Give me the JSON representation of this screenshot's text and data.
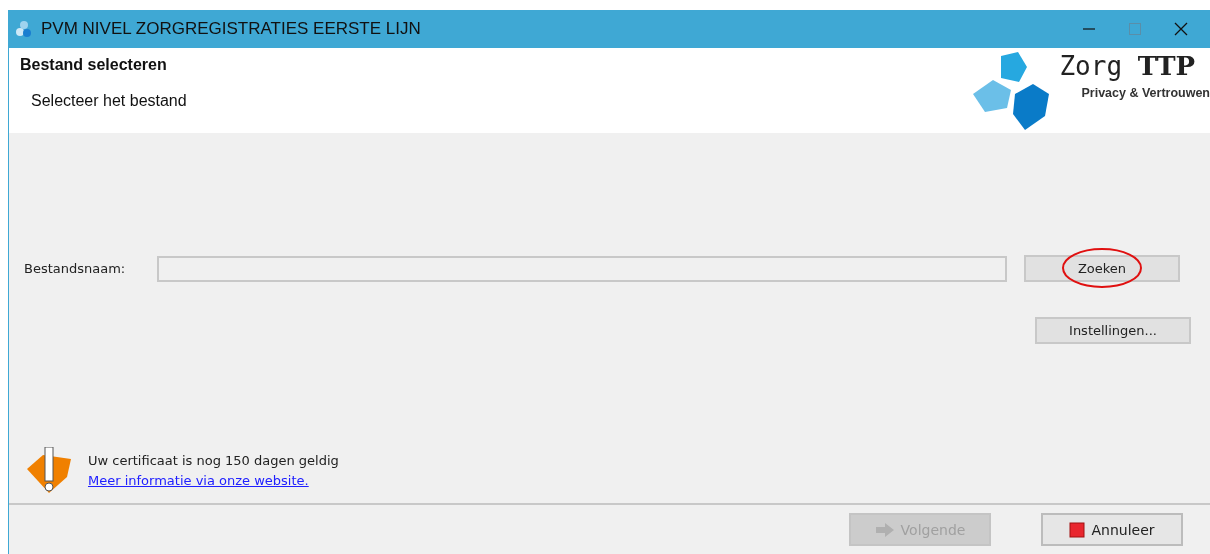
{
  "window": {
    "title": "PVM NIVEL ZORGREGISTRATIES EERSTE LIJN"
  },
  "header": {
    "title": "Bestand selecteren",
    "subtitle": "Selecteer het bestand",
    "logo": {
      "word": "Zorg",
      "bold_word": "TTP",
      "tagline": "Privacy & Vertrouwen"
    }
  },
  "form": {
    "label": "Bestandsnaam:"
  },
  "buttons": [
    {
      "label": "Zoeken",
      "highlighted": true
    },
    {
      "label": "Instellingen...",
      "highlighted": false
    }
  ],
  "notice": {
    "text": "Uw certificaat is nog 150 dagen geldig",
    "link": "Meer informatie via onze website."
  },
  "footer_buttons": [
    {
      "kind": "next",
      "label": "Volgende",
      "disabled": true
    },
    {
      "kind": "cancel",
      "label": "Annuleer",
      "disabled": false
    }
  ]
}
